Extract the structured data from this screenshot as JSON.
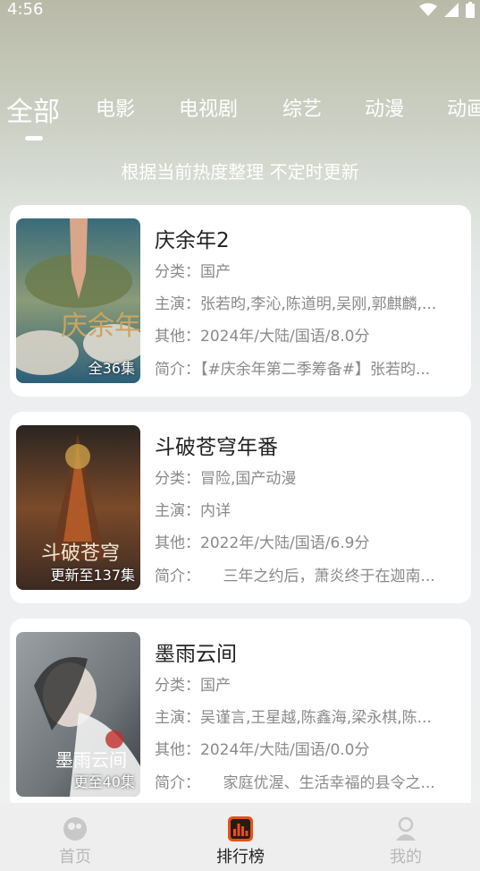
{
  "status_bar": {
    "time": "4:56"
  },
  "tabs": [
    "全部",
    "电影",
    "电视剧",
    "综艺",
    "动漫",
    "动画"
  ],
  "active_tab": "全部",
  "subtitle": "根据当前热度整理 不定时更新",
  "cards": [
    {
      "title": "庆余年2",
      "category_label": "分类：",
      "category": "国产",
      "cast_label": "主演：",
      "cast": "张若昀,李沁,陈道明,吴刚,郭麒麟,...",
      "other_label": "其他：",
      "other": "2024年/大陆/国语/8.0分",
      "intro_label": "简介：",
      "intro": "【#庆余年第二季筹备#】张若昀...",
      "badge": "全36集",
      "poster_text": "庆余年"
    },
    {
      "title": "斗破苍穹年番",
      "category_label": "分类：",
      "category": "冒险,国产动漫",
      "cast_label": "主演：",
      "cast": "内详",
      "other_label": "其他：",
      "other": "2022年/大陆/国语/6.9分",
      "intro_label": "简介：",
      "intro": "　　三年之约后，萧炎终于在迦南...",
      "badge": "更新至137集",
      "poster_text": "斗破苍穹"
    },
    {
      "title": "墨雨云间",
      "category_label": "分类：",
      "category": "国产",
      "cast_label": "主演：",
      "cast": "吴谨言,王星越,陈鑫海,梁永棋,陈...",
      "other_label": "其他：",
      "other": "2024年/大陆/国语/0.0分",
      "intro_label": "简介：",
      "intro": "　　家庭优渥、生活幸福的县令之...",
      "badge": "更至40集",
      "poster_text": "墨雨云间"
    }
  ],
  "bottom_nav": {
    "home": "首页",
    "ranking": "排行榜",
    "mine": "我的"
  },
  "colors": {
    "accent": "#e8501a",
    "inactive": "#b8b8b8"
  }
}
